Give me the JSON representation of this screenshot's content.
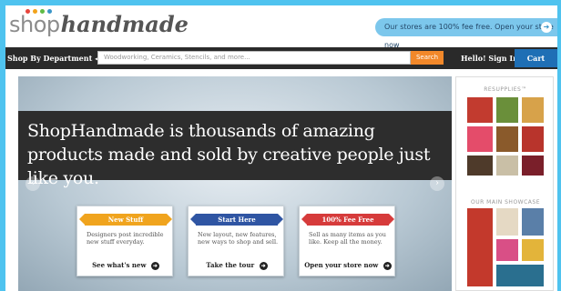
{
  "header": {
    "logo_shop": "shop",
    "logo_handmade": "handmade",
    "promo_text": "Our stores are 100% fee free. Open your store now",
    "logo_dot_colors": [
      "#e8453c",
      "#f2a31b",
      "#5fbb46",
      "#3a95c8"
    ]
  },
  "nav": {
    "department_label": "Shop By Department ◂",
    "search_placeholder": "Woodworking, Ceramics, Stencils, and more...",
    "search_button": "Search",
    "signin_label": "Hello! Sign In ◂",
    "cart_label": "Cart"
  },
  "hero": {
    "headline": "ShopHandmade is thousands of amazing products made and sold by creative people just like you.",
    "cards": [
      {
        "ribbon": "New Stuff",
        "ribbon_color": "#f0a41e",
        "body": "Designers post incredible new stuff everyday.",
        "link": "See what's new"
      },
      {
        "ribbon": "Start Here",
        "ribbon_color": "#2f55a3",
        "body": "New layout, new features, new ways to shop and sell.",
        "link": "Take the tour"
      },
      {
        "ribbon": "100% Fee Free",
        "ribbon_color": "#d63b3b",
        "body": "Sell as many items as you like. Keep all the money.",
        "link": "Open your store now"
      }
    ]
  },
  "sidebar": {
    "section1_title": "RESUPPLIES™",
    "section2_title": "OUR MAIN SHOWCASE"
  }
}
